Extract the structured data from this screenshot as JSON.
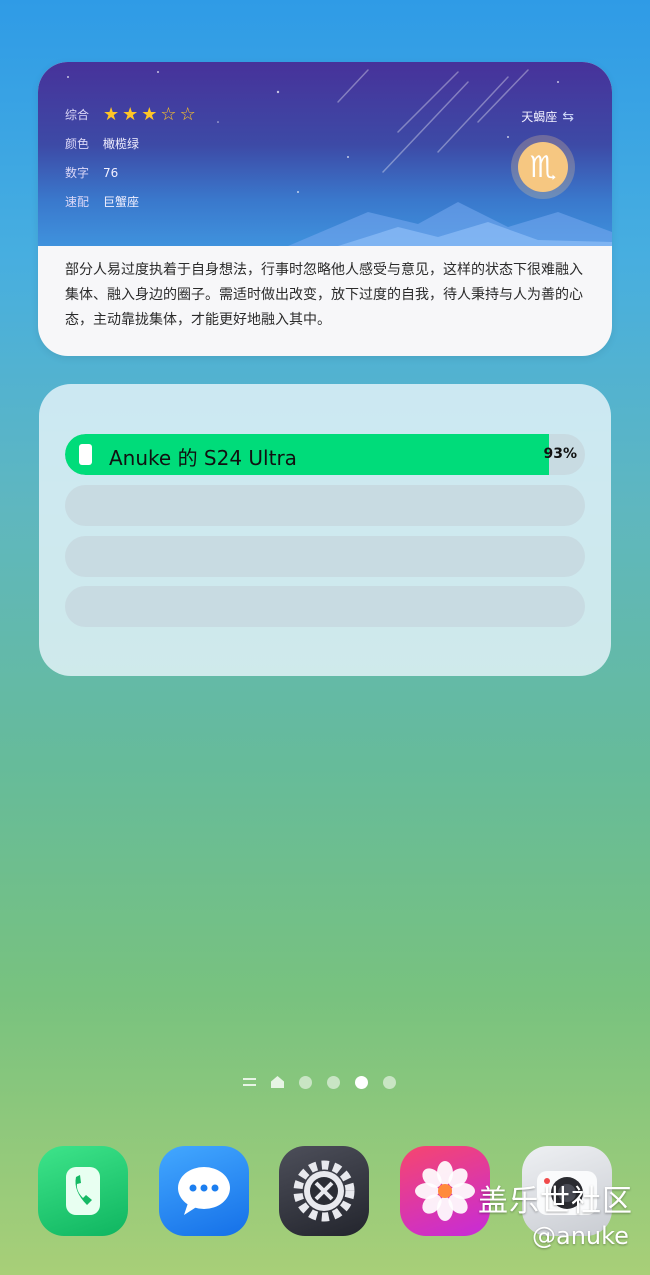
{
  "horoscope": {
    "rows": [
      {
        "label": "综合",
        "type": "rating",
        "rating": 3,
        "max": 5
      },
      {
        "label": "颜色",
        "value": "橄榄绿"
      },
      {
        "label": "数字",
        "value": "76"
      },
      {
        "label": "速配",
        "value": "巨蟹座"
      }
    ],
    "sign_name": "天蝎座",
    "sign_symbol": "♏",
    "description": "部分人易过度执着于自身想法，行事时忽略他人感受与意见，这样的状态下很难融入集体、融入身边的圈子。需适时做出改变，放下过度的自我，待人秉持与人为善的心态，主动靠拢集体，才能更好地融入其中。"
  },
  "battery": {
    "devices": [
      {
        "name": "Anuke 的 S24 Ultra",
        "percent": 93,
        "percent_label": "93%"
      },
      {
        "name": "",
        "percent": 0,
        "percent_label": ""
      },
      {
        "name": "",
        "percent": 0,
        "percent_label": ""
      },
      {
        "name": "",
        "percent": 0,
        "percent_label": ""
      }
    ],
    "fill_color": "#00dc7a"
  },
  "pager": {
    "pages": 4,
    "active_index": 2
  },
  "dock": [
    {
      "name": "phone-app",
      "icon": "phone-icon"
    },
    {
      "name": "messages-app",
      "icon": "message-bubble-icon"
    },
    {
      "name": "settings-app",
      "icon": "gear-icon"
    },
    {
      "name": "gallery-app",
      "icon": "flower-icon"
    },
    {
      "name": "camera-app",
      "icon": "camera-icon"
    }
  ],
  "watermark": {
    "line1": "盖乐世社区",
    "line2": "@anuke"
  }
}
